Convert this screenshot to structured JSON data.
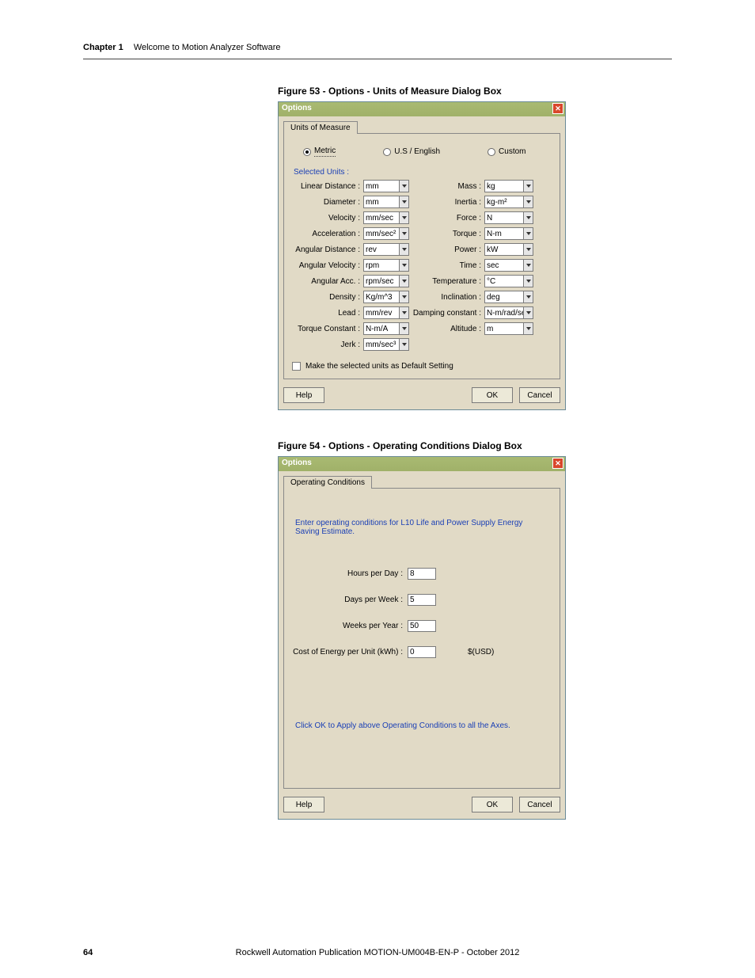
{
  "header": {
    "chapter_label": "Chapter 1",
    "chapter_title": "Welcome to Motion Analyzer Software"
  },
  "footer": {
    "page_number": "64",
    "publication": "Rockwell Automation Publication MOTION-UM004B-EN-P - October 2012"
  },
  "figure53": {
    "caption": "Figure 53 - Options - Units of Measure Dialog Box",
    "dialog_title": "Options",
    "tab_label": "Units of Measure",
    "radio_metric": "Metric",
    "radio_us": "U.S / English",
    "radio_custom": "Custom",
    "selected_units_label": "Selected Units :",
    "left_fields": [
      {
        "label": "Linear Distance :",
        "value": "mm"
      },
      {
        "label": "Diameter :",
        "value": "mm"
      },
      {
        "label": "Velocity :",
        "value": "mm/sec"
      },
      {
        "label": "Acceleration :",
        "value": "mm/sec²"
      },
      {
        "label": "Angular Distance :",
        "value": "rev"
      },
      {
        "label": "Angular Velocity :",
        "value": "rpm"
      },
      {
        "label": "Angular Acc. :",
        "value": "rpm/sec"
      },
      {
        "label": "Density :",
        "value": "Kg/m^3"
      },
      {
        "label": "Lead :",
        "value": "mm/rev"
      },
      {
        "label": "Torque Constant :",
        "value": "N-m/A"
      },
      {
        "label": "Jerk :",
        "value": "mm/sec³"
      }
    ],
    "right_fields": [
      {
        "label": "Mass :",
        "value": "kg"
      },
      {
        "label": "Inertia :",
        "value": "kg-m²"
      },
      {
        "label": "Force :",
        "value": "N"
      },
      {
        "label": "Torque :",
        "value": "N-m"
      },
      {
        "label": "Power :",
        "value": "kW"
      },
      {
        "label": "Time :",
        "value": "sec"
      },
      {
        "label": "Temperature :",
        "value": "°C"
      },
      {
        "label": "Inclination :",
        "value": "deg"
      },
      {
        "label": "Damping constant :",
        "value": "N-m/rad/sec"
      },
      {
        "label": "Altitude :",
        "value": "m"
      }
    ],
    "default_checkbox_label": "Make the selected units as Default Setting",
    "help_label": "Help",
    "ok_label": "OK",
    "cancel_label": "Cancel"
  },
  "figure54": {
    "caption": "Figure 54 - Options - Operating Conditions Dialog Box",
    "dialog_title": "Options",
    "tab_label": "Operating Conditions",
    "instruction": "Enter operating conditions for L10 Life and Power Supply Energy Saving Estimate.",
    "fields": [
      {
        "label": "Hours per Day :",
        "value": "8",
        "suffix": ""
      },
      {
        "label": "Days per Week :",
        "value": "5",
        "suffix": ""
      },
      {
        "label": "Weeks per Year :",
        "value": "50",
        "suffix": ""
      },
      {
        "label": "Cost of Energy per Unit (kWh) :",
        "value": "0",
        "suffix": "$(USD)"
      }
    ],
    "apply_note": "Click OK to Apply above Operating Conditions to all the Axes.",
    "help_label": "Help",
    "ok_label": "OK",
    "cancel_label": "Cancel"
  }
}
